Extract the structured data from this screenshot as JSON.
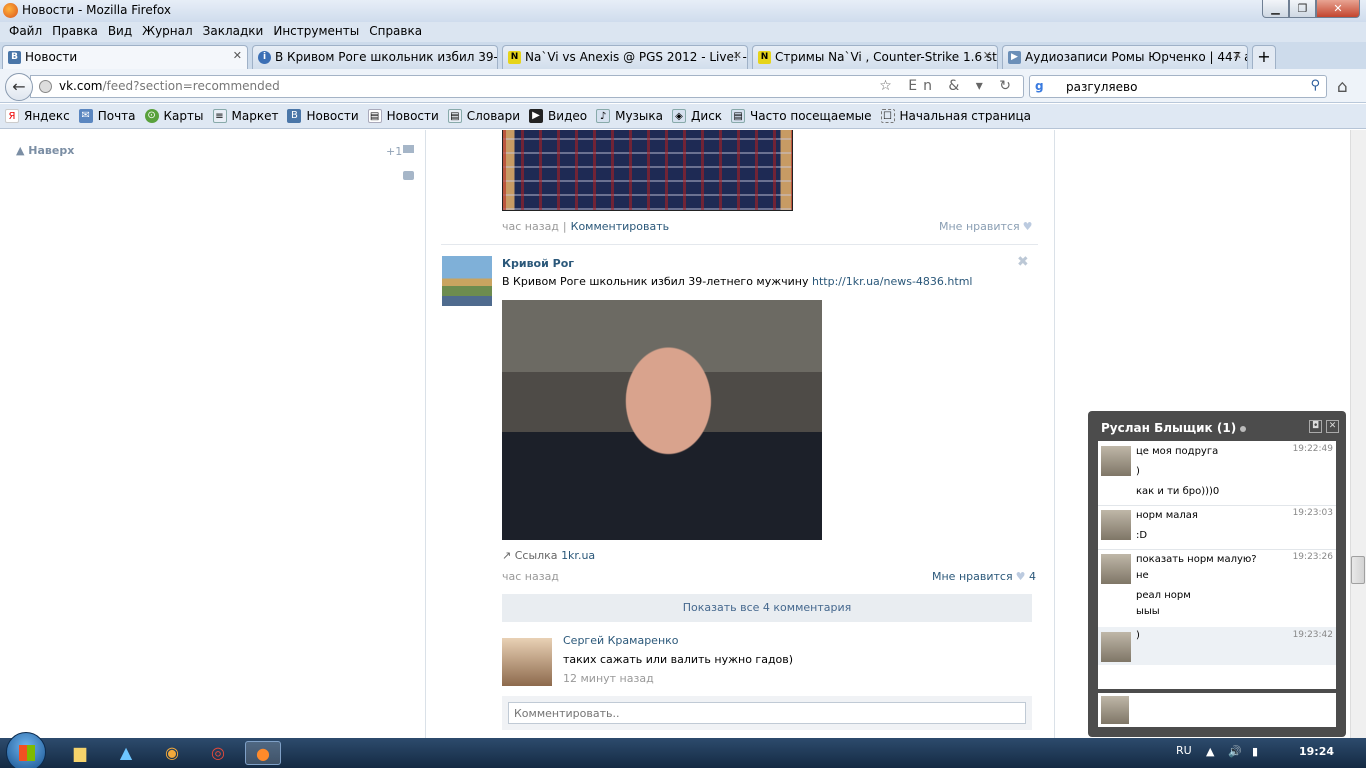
{
  "window": {
    "title": "Новости - Mozilla Firefox"
  },
  "menu": [
    "Файл",
    "Правка",
    "Вид",
    "Журнал",
    "Закладки",
    "Инструменты",
    "Справка"
  ],
  "tabs": [
    {
      "label": "Новости",
      "icon": "В"
    },
    {
      "label": "В Кривом Роге школьник избил 39-...",
      "icon": "i"
    },
    {
      "label": "Na`Vi vs Anexis @ PGS 2012 - Live! - ...",
      "icon": "N"
    },
    {
      "label": "Стримы Na`Vi , Counter-Strike 1.6 str...",
      "icon": "N"
    },
    {
      "label": "Аудиозаписи Ромы Юрченко | 447 а...",
      "icon": "▶"
    }
  ],
  "nav": {
    "url_host": "vk.com",
    "url_path": "/feed?section=recommended",
    "url_icons": "☆ En & ▾ ↻",
    "search_engine_icon": "g",
    "search_query": "разгуляево"
  },
  "bookmarks": [
    {
      "label": "Яндекс",
      "icon": "Я"
    },
    {
      "label": "Почта",
      "icon": "✉"
    },
    {
      "label": "Карты",
      "icon": "⊙"
    },
    {
      "label": "Маркет",
      "icon": "≡"
    },
    {
      "label": "Новости",
      "icon": "В"
    },
    {
      "label": "Новости",
      "icon": "▤"
    },
    {
      "label": "Словари",
      "icon": "▤"
    },
    {
      "label": "Видео",
      "icon": "▶"
    },
    {
      "label": "Музыка",
      "icon": "♪"
    },
    {
      "label": "Диск",
      "icon": "◈"
    },
    {
      "label": "Часто посещаемые",
      "icon": "▤"
    },
    {
      "label": "Начальная страница",
      "icon": "☐"
    }
  ],
  "left": {
    "up_label": "Наверх",
    "plus_count": "+1"
  },
  "prev_post": {
    "time": "час назад",
    "comment_link": "Комментировать",
    "like_label": "Мне нравится"
  },
  "post": {
    "author": "Кривой Рог",
    "text": "В Кривом Роге школьник избил 39-летнего мужчину",
    "url": "http://1kr.ua/news-4836.html",
    "link_label": "Ссылка",
    "link_domain": "1kr.ua",
    "time": "час назад",
    "like_label": "Мне нравится",
    "like_count": "4",
    "show_all_comments": "Показать все 4 комментария"
  },
  "comment": {
    "name": "Сергей Крамаренко",
    "text": "таких сажать или валить нужно гадов)",
    "time": "12 минут назад",
    "placeholder": "Комментировать.."
  },
  "chat": {
    "title": "Руслан Блыщик (1)",
    "messages": [
      {
        "time": "19:22:49",
        "lines": [
          "це моя подруга",
          ")",
          "как и ти бро)))0"
        ]
      },
      {
        "time": "19:23:03",
        "lines": [
          "норм малая",
          ":D"
        ]
      },
      {
        "time": "19:23:26",
        "lines": [
          "показать норм малую?",
          "не",
          "реал норм",
          "ыыы"
        ]
      },
      {
        "time": "19:23:42",
        "lines": [
          ")"
        ]
      }
    ]
  },
  "taskbar": {
    "lang": "RU",
    "clock": "19:24"
  }
}
